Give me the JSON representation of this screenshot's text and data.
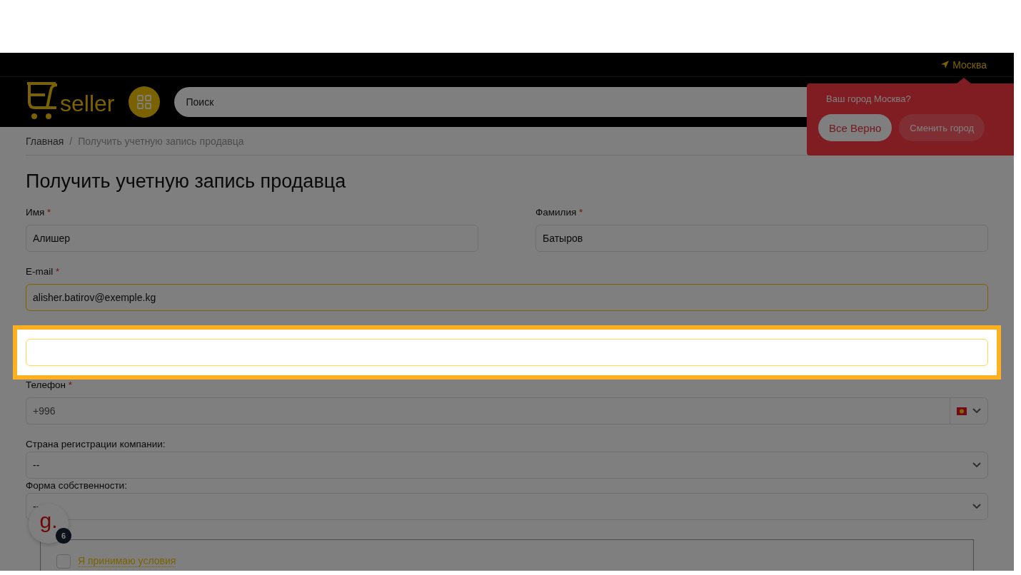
{
  "location": {
    "city": "Москва"
  },
  "header": {
    "logo": "seller",
    "search": {
      "placeholder": "Поиск"
    }
  },
  "city_popup": {
    "question": "Ваш город Москва?",
    "buttons": [
      {
        "label": "Все Верно",
        "kind": "primary"
      },
      {
        "label": "Сменить город",
        "kind": "secondary"
      }
    ]
  },
  "breadcrumb": {
    "separator": "/",
    "items": [
      "Главная",
      "Получить учетную запись продавца"
    ]
  },
  "title": "Получить учетную запись продавца",
  "rows": [
    [
      {
        "kind": "text",
        "label": "Имя",
        "required_mark": "*",
        "value": "Алишер",
        "focused": false
      },
      {
        "kind": "text",
        "label": "Фамилия",
        "required_mark": "*",
        "value": "Батыров",
        "focused": false
      }
    ],
    [
      {
        "kind": "text",
        "label": "E-mail",
        "required_mark": "*",
        "value": "alisher.batirov@exemple.kg",
        "focused": true
      }
    ],
    [
      {
        "kind": "spotlight",
        "focused": true
      }
    ],
    [
      {
        "kind": "phone",
        "label": "Телефон",
        "required_mark": "*",
        "placeholder": "+996"
      }
    ],
    [
      {
        "kind": "select",
        "label": "Страна регистрации компании:",
        "value": "--"
      }
    ],
    [
      {
        "kind": "select",
        "label": "Форма собственности:",
        "value": "--"
      }
    ]
  ],
  "agreement": {
    "label": "Я принимаю условия",
    "checked": false
  },
  "chat_widget": {
    "logo": "g.",
    "badge": "6"
  }
}
